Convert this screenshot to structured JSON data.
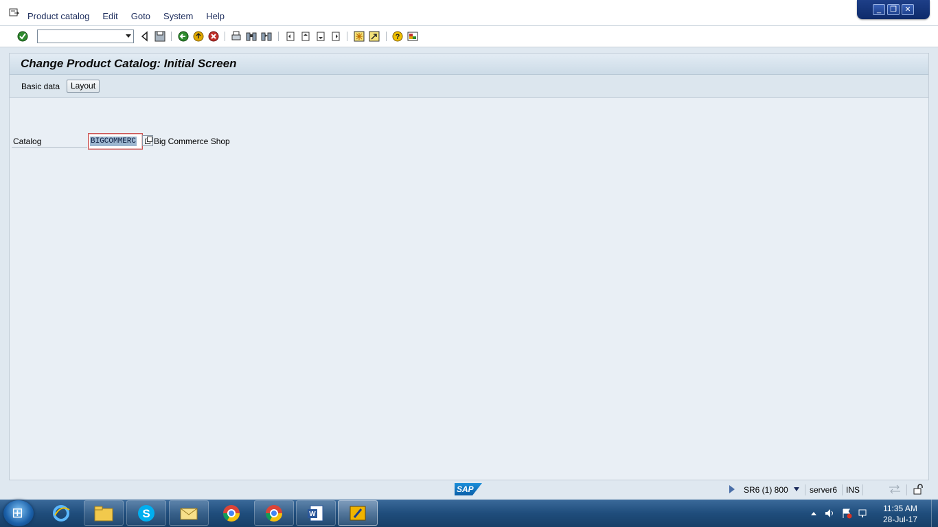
{
  "menubar": {
    "items": [
      "Product catalog",
      "Edit",
      "Goto",
      "System",
      "Help"
    ]
  },
  "toolbar": {
    "command_field": {
      "value": ""
    },
    "icons": [
      "enter-icon",
      "back-icon",
      "save-icon",
      "back-green-icon",
      "exit-icon",
      "cancel-icon",
      "print-icon",
      "find-icon",
      "find-next-icon",
      "first-page-icon",
      "previous-page-icon",
      "next-page-icon",
      "last-page-icon",
      "create-session-icon",
      "create-shortcut-icon",
      "help-icon",
      "layout-menu-icon"
    ]
  },
  "screen": {
    "title": "Change Product Catalog: Initial Screen",
    "app_toolbar": {
      "basic_data": "Basic data",
      "layout_button": "Layout"
    },
    "catalog": {
      "label": "Catalog",
      "value": "BIGCOMMERC",
      "description": "Big Commerce Shop"
    }
  },
  "statusbar": {
    "logo": "SAP",
    "system": "SR6 (1) 800",
    "server": "server6",
    "mode": "INS"
  },
  "taskbar": {
    "apps": [
      "internet-explorer-icon",
      "file-explorer-icon",
      "skype-icon",
      "outlook-icon",
      "chrome-icon",
      "chrome-icon",
      "word-icon",
      "sap-logon-icon"
    ],
    "clock": {
      "time": "11:35 AM",
      "date": "28-Jul-17"
    }
  },
  "colors": {
    "accent": "#1c8fd9",
    "background": "#e9eff5",
    "title_gradient_bottom": "#ccdbe7"
  }
}
